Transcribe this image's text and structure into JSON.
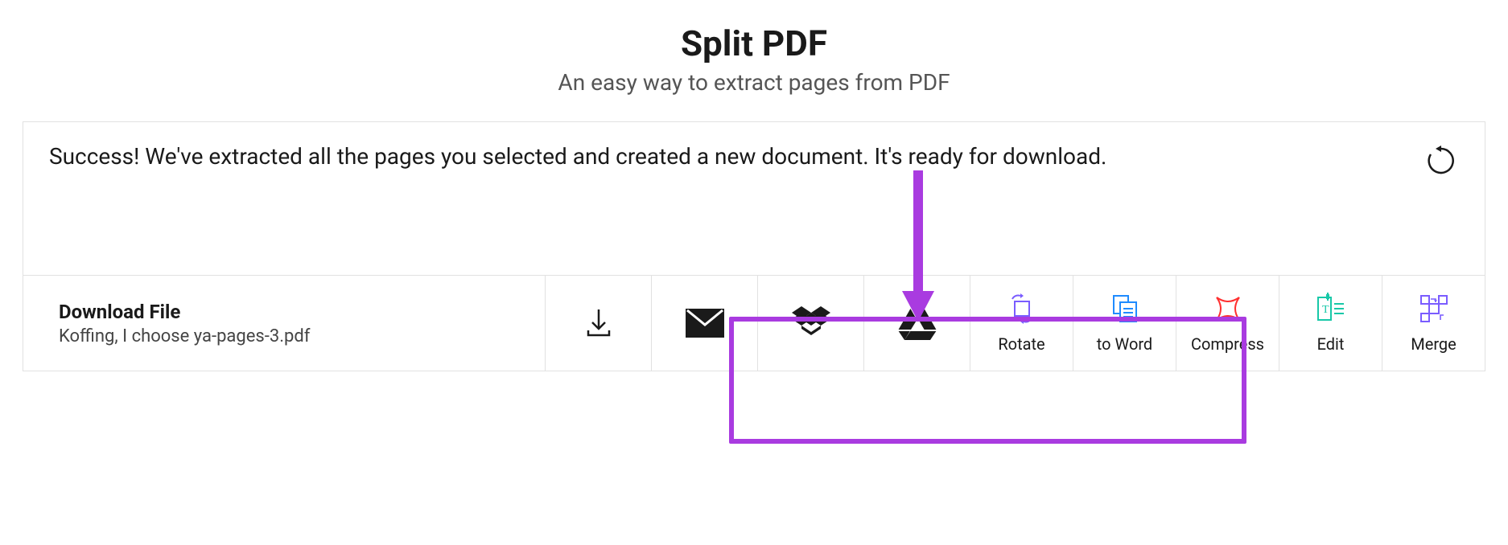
{
  "header": {
    "title": "Split PDF",
    "subtitle": "An easy way to extract pages from PDF"
  },
  "message": "Success! We've extracted all the pages you selected and created a new document. It's ready for download.",
  "download": {
    "label": "Download File",
    "filename": "Koffing, I choose ya-pages-3.pdf"
  },
  "tools": {
    "rotate": "Rotate",
    "toword": "to Word",
    "compress": "Compress",
    "edit": "Edit",
    "merge": "Merge"
  }
}
